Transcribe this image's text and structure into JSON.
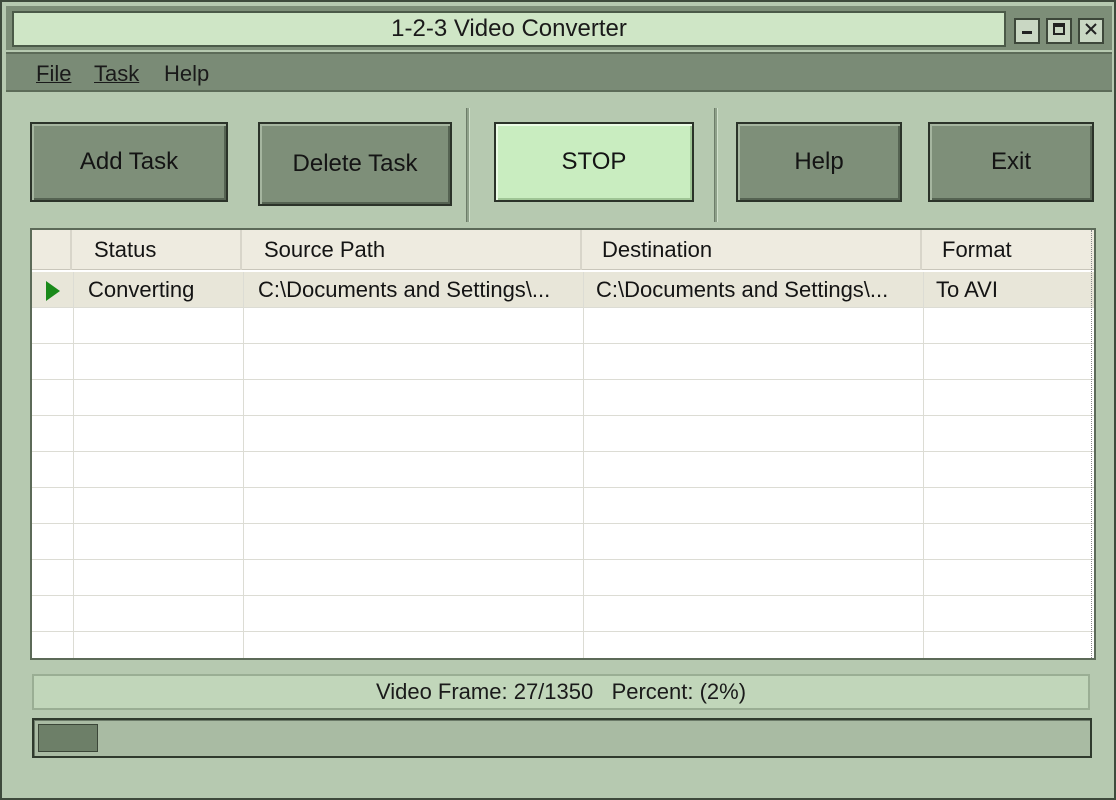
{
  "window": {
    "title": "1-2-3 Video Converter"
  },
  "title_controls": {
    "minimize_icon": "minimize-icon",
    "maximize_icon": "maximize-icon",
    "close_icon": "close-icon"
  },
  "menu": {
    "file": "File",
    "task": "Task",
    "help": "Help"
  },
  "toolbar": {
    "add_task": "Add Task",
    "delete_task": "Delete Task",
    "stop": "STOP",
    "help": "Help",
    "exit": "Exit"
  },
  "table": {
    "columns": [
      "Status",
      "Source Path",
      "Destination",
      "Format"
    ],
    "rows": [
      {
        "status": "Converting",
        "source": "C:\\Documents and Settings\\...",
        "destination": "C:\\Documents and Settings\\...",
        "format": "To AVI"
      }
    ]
  },
  "status": {
    "text": "Video Frame: 27/1350   Percent: (2%)"
  },
  "progress": {
    "percent": 2
  },
  "colors": {
    "indicator": "#1a8a1a",
    "stop_button": "#c9edc0"
  }
}
